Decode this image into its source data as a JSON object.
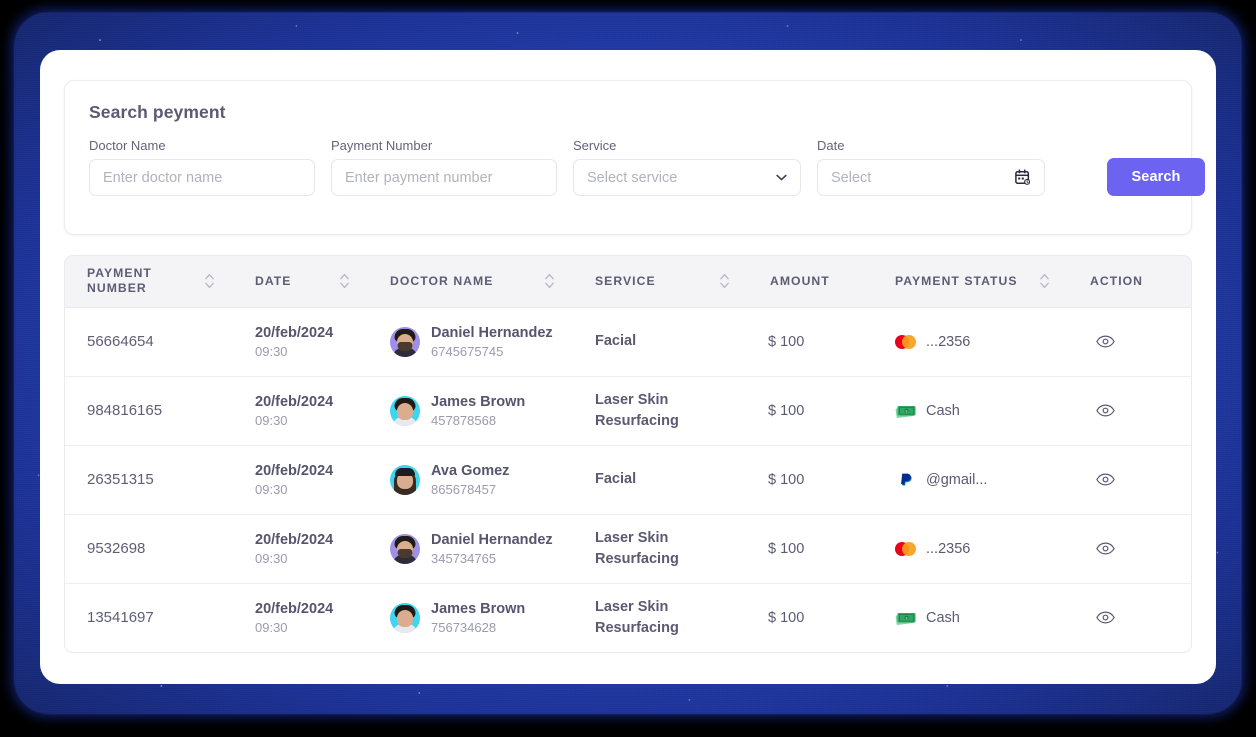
{
  "search_panel": {
    "title": "Search peyment",
    "fields": [
      {
        "label": "Doctor Name",
        "placeholder": "Enter doctor name",
        "value": "",
        "type": "text"
      },
      {
        "label": "Payment Number",
        "placeholder": "Enter payment number",
        "value": "",
        "type": "text"
      },
      {
        "label": "Service",
        "placeholder": "Select service",
        "value": "",
        "type": "select"
      },
      {
        "label": "Date",
        "placeholder": "Select",
        "value": "",
        "type": "date"
      }
    ],
    "search_button": "Search",
    "accent_color": "#6c63f0"
  },
  "table": {
    "columns": [
      {
        "key": "payment_number",
        "label": "PAYMENT NUMBER",
        "sortable": true
      },
      {
        "key": "date",
        "label": "DATE",
        "sortable": true
      },
      {
        "key": "doctor_name",
        "label": "DOCTOR NAME",
        "sortable": true
      },
      {
        "key": "service",
        "label": "SERVICE",
        "sortable": true
      },
      {
        "key": "amount",
        "label": "AMOUNT",
        "sortable": false
      },
      {
        "key": "payment_status",
        "label": "PAYMENT STATUS",
        "sortable": true
      },
      {
        "key": "action",
        "label": "ACTION",
        "sortable": false
      }
    ],
    "rows": [
      {
        "payment_number": "56664654",
        "date": "20/feb/2024",
        "time": "09:30",
        "doctor_name": "Daniel Hernandez",
        "doctor_id": "6745675745",
        "avatar": "avatar-daniel-hernandez",
        "service": "Facial",
        "amount": "$ 100",
        "payment_status": "...2356",
        "payment_method_icon": "mastercard-icon",
        "action_icon": "eye-icon"
      },
      {
        "payment_number": "984816165",
        "date": "20/feb/2024",
        "time": "09:30",
        "doctor_name": "James Brown",
        "doctor_id": "457878568",
        "avatar": "avatar-james-brown",
        "service": "Laser Skin Resurfacing",
        "amount": "$ 100",
        "payment_status": "Cash",
        "payment_method_icon": "cash-icon",
        "action_icon": "eye-icon"
      },
      {
        "payment_number": "26351315",
        "date": "20/feb/2024",
        "time": "09:30",
        "doctor_name": "Ava Gomez",
        "doctor_id": "865678457",
        "avatar": "avatar-ava-gomez",
        "service": "Facial",
        "amount": "$ 100",
        "payment_status": "@gmail...",
        "payment_method_icon": "paypal-icon",
        "action_icon": "eye-icon"
      },
      {
        "payment_number": "9532698",
        "date": "20/feb/2024",
        "time": "09:30",
        "doctor_name": "Daniel Hernandez",
        "doctor_id": "345734765",
        "avatar": "avatar-daniel-hernandez",
        "service": "Laser Skin Resurfacing",
        "amount": "$ 100",
        "payment_status": "...2356",
        "payment_method_icon": "mastercard-icon",
        "action_icon": "eye-icon"
      },
      {
        "payment_number": "13541697",
        "date": "20/feb/2024",
        "time": "09:30",
        "doctor_name": "James Brown",
        "doctor_id": "756734628",
        "avatar": "avatar-james-brown",
        "service": "Laser Skin Resurfacing",
        "amount": "$ 100",
        "payment_status": "Cash",
        "payment_method_icon": "cash-icon",
        "action_icon": "eye-icon"
      }
    ]
  }
}
